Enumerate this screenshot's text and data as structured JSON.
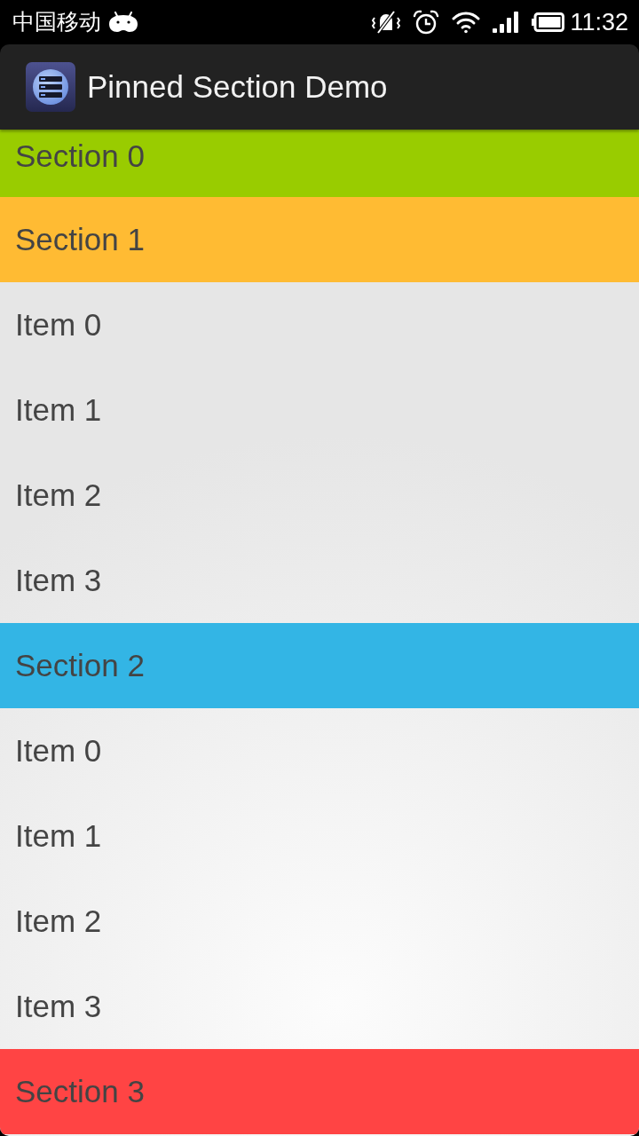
{
  "status_bar": {
    "carrier": "中国移动",
    "time": "11:32"
  },
  "action_bar": {
    "title": "Pinned Section Demo"
  },
  "pinned_header": {
    "label": "Section 0",
    "color": "#99cc00"
  },
  "rows": [
    {
      "kind": "section",
      "label": "Section 1",
      "color": "#ffbb33"
    },
    {
      "kind": "item",
      "label": "Item 0"
    },
    {
      "kind": "item",
      "label": "Item 1"
    },
    {
      "kind": "item",
      "label": "Item 2"
    },
    {
      "kind": "item",
      "label": "Item 3"
    },
    {
      "kind": "section",
      "label": "Section 2",
      "color": "#33b5e5"
    },
    {
      "kind": "item",
      "label": "Item 0"
    },
    {
      "kind": "item",
      "label": "Item 1"
    },
    {
      "kind": "item",
      "label": "Item 2"
    },
    {
      "kind": "item",
      "label": "Item 3"
    },
    {
      "kind": "section",
      "label": "Section 3",
      "color": "#ff4444"
    }
  ]
}
